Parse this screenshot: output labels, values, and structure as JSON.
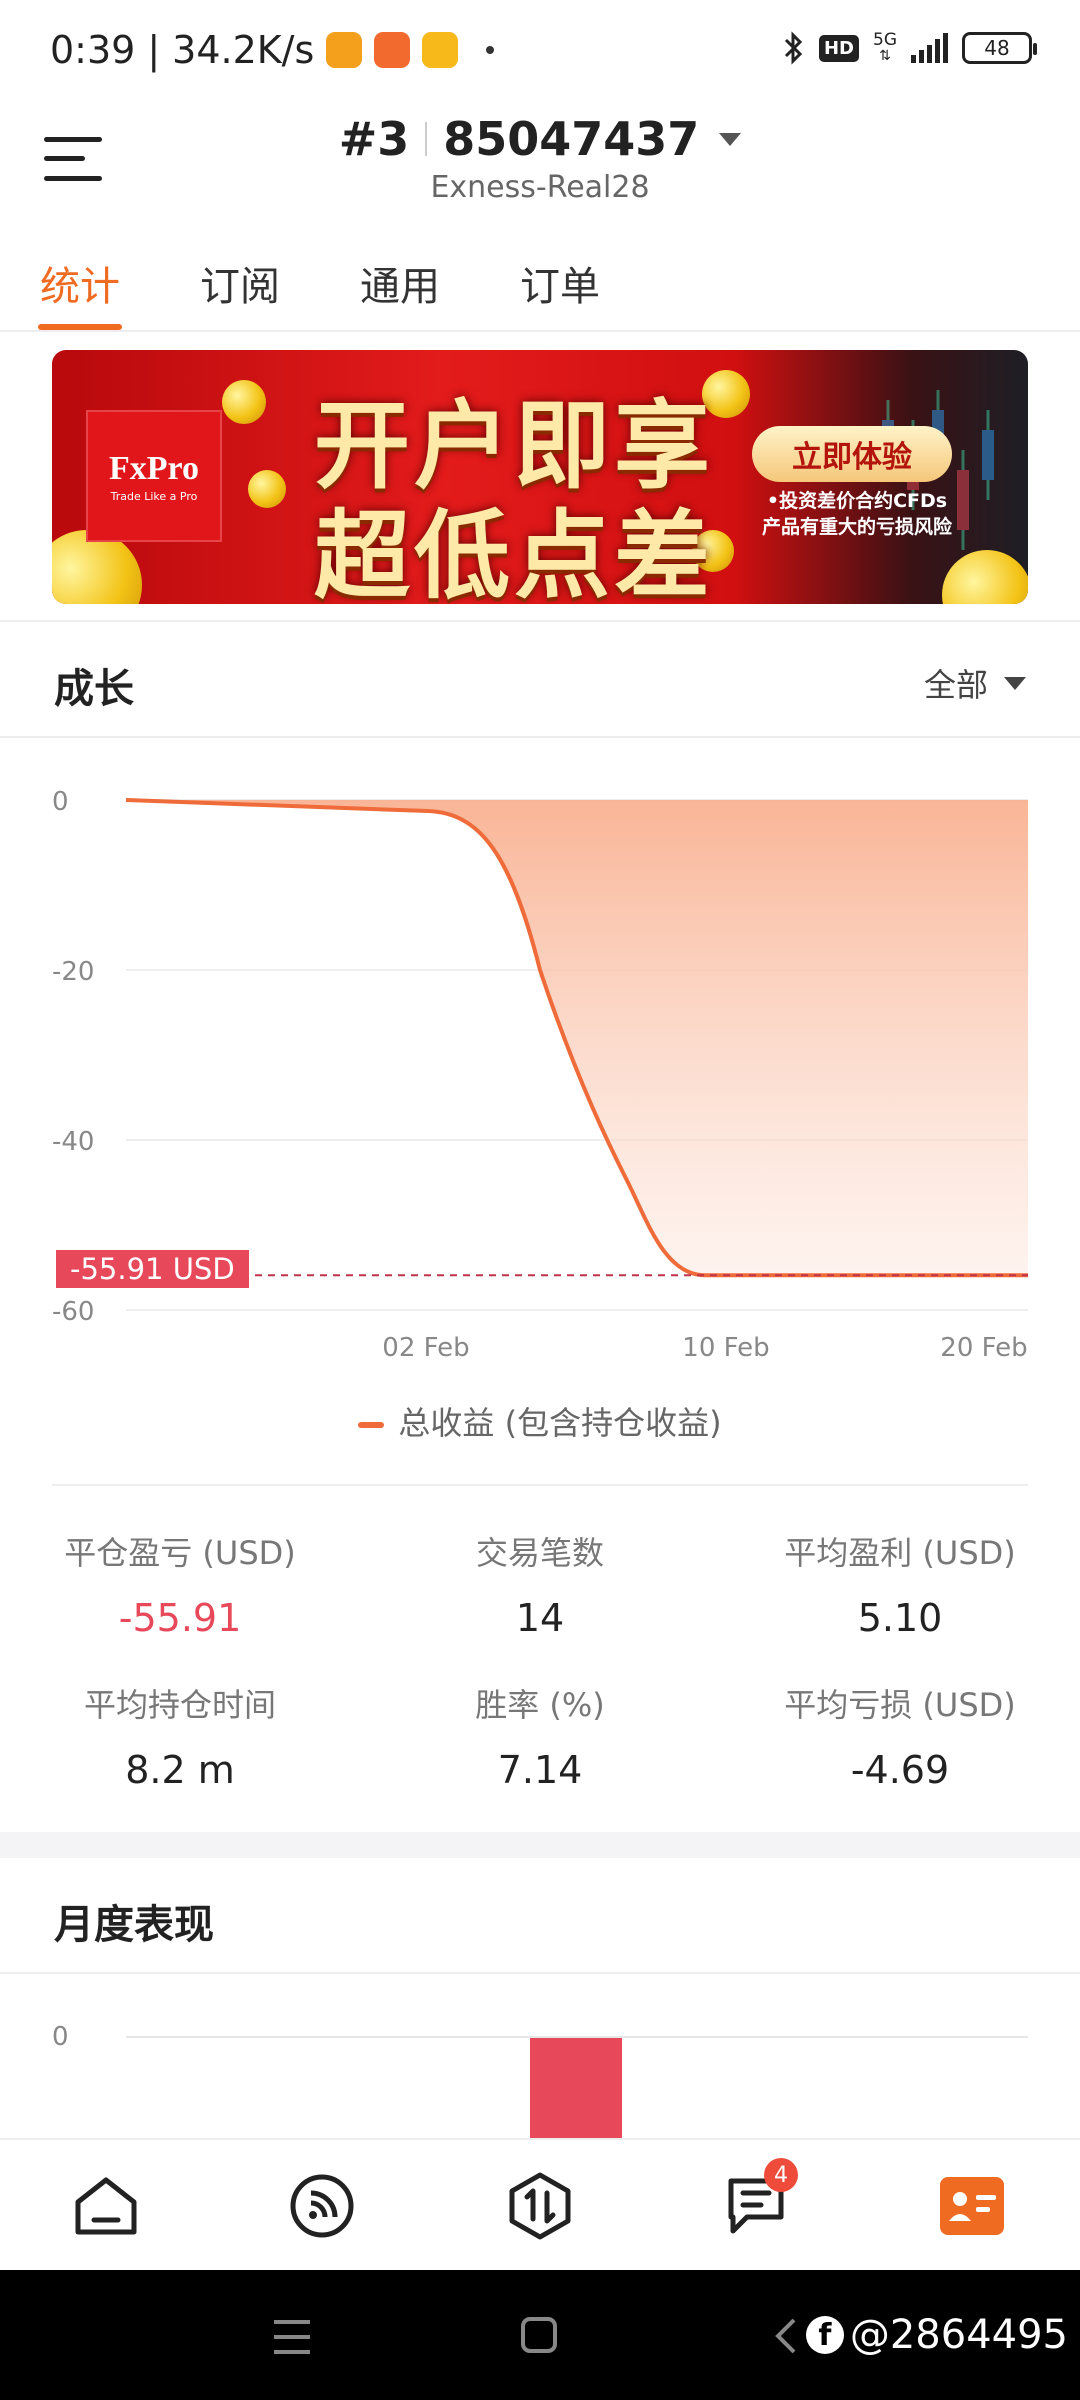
{
  "status_bar": {
    "time": "0:39",
    "speed": "34.2K/s",
    "network": "5G",
    "battery": "48",
    "hd": "HD"
  },
  "header": {
    "account_num": "#3",
    "account_id": "85047437",
    "server": "Exness-Real28"
  },
  "tabs": [
    {
      "label": "统计",
      "active": true
    },
    {
      "label": "订阅",
      "active": false
    },
    {
      "label": "通用",
      "active": false
    },
    {
      "label": "订单",
      "active": false
    }
  ],
  "banner": {
    "brand": "FxPro",
    "tagline": "Trade Like a Pro",
    "headline1": "开户即享",
    "headline2": "超低点差",
    "cta": "立即体验",
    "risk_line1": "•投资差价合约CFDs",
    "risk_line2": "产品有重大的亏损风险"
  },
  "growth": {
    "title": "成长",
    "range": "全部",
    "current_tag": "-55.91 USD",
    "legend": "总收益 (包含持仓收益)"
  },
  "chart_data": {
    "type": "area",
    "ylim": [
      -60,
      0
    ],
    "yticks": [
      0,
      -20,
      -40,
      -60
    ],
    "xticks": [
      "02 Feb",
      "10 Feb",
      "20 Feb"
    ],
    "series": [
      {
        "name": "总收益 (包含持仓收益)",
        "color": "#ef6b3a",
        "points": [
          [
            "start",
            0
          ],
          [
            "02 Feb",
            -1.3
          ],
          [
            "mid",
            -20
          ],
          [
            "late",
            -45
          ],
          [
            "10 Feb",
            -55.91
          ],
          [
            "20 Feb",
            -55.91
          ]
        ]
      }
    ],
    "current_value": -55.91
  },
  "stats": [
    {
      "label": "平仓盈亏 (USD)",
      "value": "-55.91",
      "negative": true
    },
    {
      "label": "交易笔数",
      "value": "14",
      "negative": false
    },
    {
      "label": "平均盈利 (USD)",
      "value": "5.10",
      "negative": false
    },
    {
      "label": "平均持仓时间",
      "value": "8.2 m",
      "negative": false
    },
    {
      "label": "胜率 (%)",
      "value": "7.14",
      "negative": false
    },
    {
      "label": "平均亏损 (USD)",
      "value": "-4.69",
      "negative": false
    }
  ],
  "monthly": {
    "title": "月度表现",
    "y_label": "0",
    "bar_color": "#e8495a"
  },
  "bottom_nav": {
    "items": [
      "home-icon",
      "signal-icon",
      "trade-icon",
      "messages-icon",
      "profile-icon"
    ],
    "messages_badge": "4"
  },
  "watermark": "@2864495",
  "colors": {
    "accent": "#f06b22",
    "negative": "#e8495a",
    "line": "#ef6b3a"
  }
}
